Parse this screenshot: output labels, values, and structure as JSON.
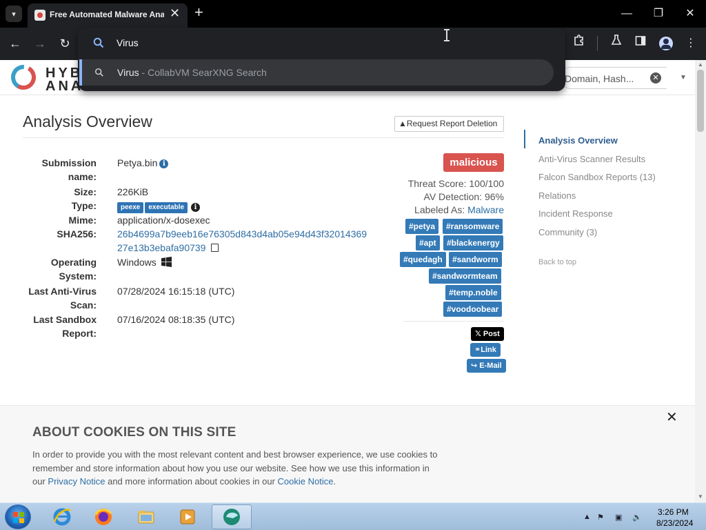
{
  "browser": {
    "tab_title": "Free Automated Malware Ana",
    "omnibox_value": "Virus",
    "suggestion_main": "Virus",
    "suggestion_rest": " - CollabVM SearXNG Search"
  },
  "site": {
    "logo_line1": "HYB",
    "logo_line2": "ANA",
    "search_placeholder": "Domain, Hash..."
  },
  "overview": {
    "title": "Analysis Overview",
    "request_deletion_label": "Request Report Deletion",
    "fields": [
      {
        "label": "Submission",
        "label2": "name:",
        "value": "Petya.bin"
      },
      {
        "label": "Size:",
        "value": "226KiB"
      },
      {
        "label": "Type:",
        "badges": [
          "peexe",
          "executable"
        ]
      },
      {
        "label": "Mime:",
        "value": "application/x-dosexec"
      },
      {
        "label": "SHA256:",
        "value": "26b4699a7b9eeb16e76305d843d4ab05e94d43f32014369",
        "value2": "27e13b3ebafa90739"
      },
      {
        "label": "Operating",
        "label2": "System:",
        "value": "Windows"
      },
      {
        "label": "Last Anti-Virus",
        "label2": "Scan:",
        "value": "07/28/2024 16:15:18 (UTC)"
      },
      {
        "label": "Last Sandbox",
        "label2": "Report:",
        "value": "07/16/2024 08:18:35 (UTC)"
      }
    ],
    "verdict": "malicious",
    "threat_score": "Threat Score: 100/100",
    "av_detection": "AV Detection: 96%",
    "labeled_as_prefix": "Labeled As:",
    "labeled_as_value": "Malware",
    "tags": [
      "#petya",
      "#ransomware",
      "#apt",
      "#blackenergy",
      "#quedagh",
      "#sandworm",
      "#sandwormteam",
      "#temp.noble",
      "#voodoobear"
    ],
    "share": {
      "x": "Post",
      "link": "Link",
      "mail": "E-Mail"
    }
  },
  "side_nav": {
    "items": [
      "Analysis Overview",
      "Anti-Virus Scanner Results",
      "Falcon Sandbox Reports (13)",
      "Relations",
      "Incident Response",
      "Community (3)"
    ],
    "back_to_top": "Back to top"
  },
  "cookies": {
    "title": "ABOUT COOKIES ON THIS SITE",
    "text_1": "In order to provide you with the most relevant content and best browser experience, we use cookies to remember and store information about how you use our website. See how we use this information in our ",
    "privacy_link": "Privacy Notice",
    "text_2": " and more information about cookies in our ",
    "cookie_link": "Cookie Notice",
    "text_3": "."
  },
  "taskbar": {
    "time": "3:26 PM",
    "date": "8/23/2024"
  },
  "colors": {
    "accent_blue": "#337ab7",
    "malicious_red": "#d9534f",
    "link_blue": "#2e6da4"
  }
}
